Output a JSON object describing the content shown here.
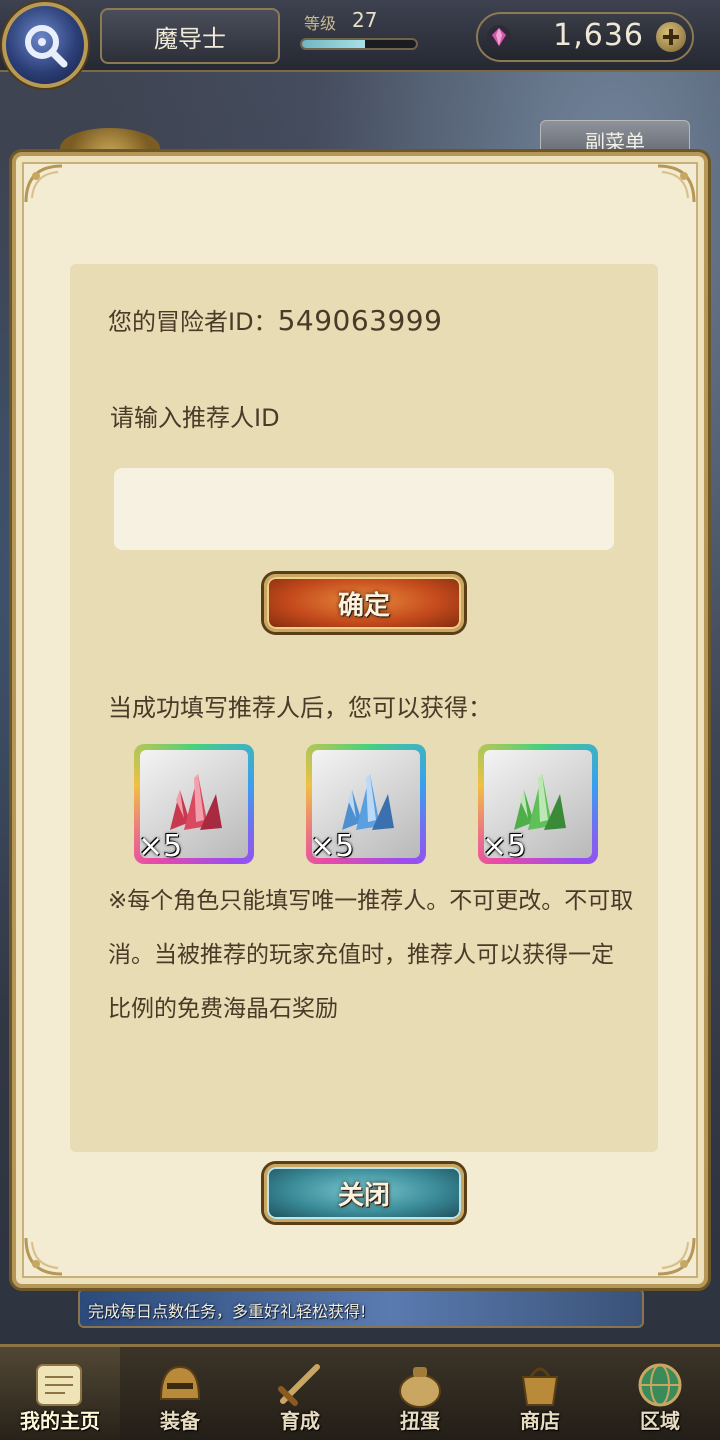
{
  "topbar": {
    "menu_icon": "search-magnifier-icon",
    "player_name": "魔导士",
    "level_label": "等级",
    "level_value": "27",
    "level_progress": 0.55,
    "currency_icon": "gem-icon",
    "currency_value": "1,636",
    "add_icon": "plus-icon"
  },
  "background": {
    "submenu_label": "副菜单",
    "banner_text": "完成每日点数任务，多重好礼轻松获得!"
  },
  "dialog": {
    "adventurer_id_label": "您的冒险者ID：",
    "adventurer_id_value": "549063999",
    "referrer_input_label": "请输入推荐人ID",
    "referrer_input_value": "",
    "confirm_label": "确定",
    "reward_intro": "当成功填写推荐人后，您可以获得：",
    "rewards": [
      {
        "icon": "red-crystal-icon",
        "color": "#c8394f",
        "count": "×5"
      },
      {
        "icon": "blue-crystal-icon",
        "color": "#4d8fd0",
        "count": "×5"
      },
      {
        "icon": "green-crystal-icon",
        "color": "#4fae4a",
        "count": "×5"
      }
    ],
    "note": "※每个角色只能填写唯一推荐人。不可更改。不可取消。当被推荐的玩家充值时，推荐人可以获得一定比例的免费海晶石奖励",
    "close_label": "关闭"
  },
  "bottom_nav": {
    "items": [
      {
        "label": "我的主页",
        "icon": "scroll-home-icon",
        "active": true
      },
      {
        "label": "装备",
        "icon": "helmet-icon",
        "active": false
      },
      {
        "label": "育成",
        "icon": "sword-icon",
        "active": false
      },
      {
        "label": "扭蛋",
        "icon": "gacha-bag-icon",
        "active": false
      },
      {
        "label": "商店",
        "icon": "shop-bag-icon",
        "active": false
      },
      {
        "label": "区域",
        "icon": "globe-icon",
        "active": false
      }
    ]
  }
}
